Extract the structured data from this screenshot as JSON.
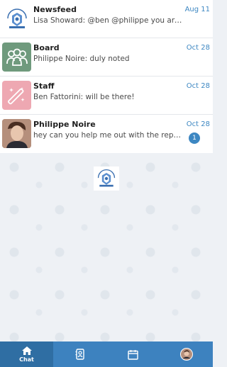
{
  "chats": [
    {
      "name": "Newsfeed",
      "preview": "Lisa Showard: @ben @philippe you are g...",
      "date": "Aug 11",
      "avatar_icon": "crest-logo-icon"
    },
    {
      "name": "Board",
      "preview": "Philippe Noire: duly noted",
      "date": "Oct 28",
      "avatar_icon": "group-icon"
    },
    {
      "name": "Staff",
      "preview": "Ben Fattorini: will be there!",
      "date": "Oct 28",
      "avatar_icon": "magic-wand-icon"
    },
    {
      "name": "Philippe Noire",
      "preview": "hey can you help me out with the report?",
      "date": "Oct 28",
      "unread": "1",
      "avatar_icon": "user-photo"
    }
  ],
  "tabbar": {
    "chat_label": "Chat",
    "tabs": [
      "chat-icon",
      "contacts-icon",
      "calendar-icon",
      "profile-avatar"
    ]
  },
  "colors": {
    "accent": "#3d87c2",
    "tabbar": "#3d82bf",
    "board_avatar": "#6f9a7d",
    "staff_avatar": "#eea8b2"
  }
}
